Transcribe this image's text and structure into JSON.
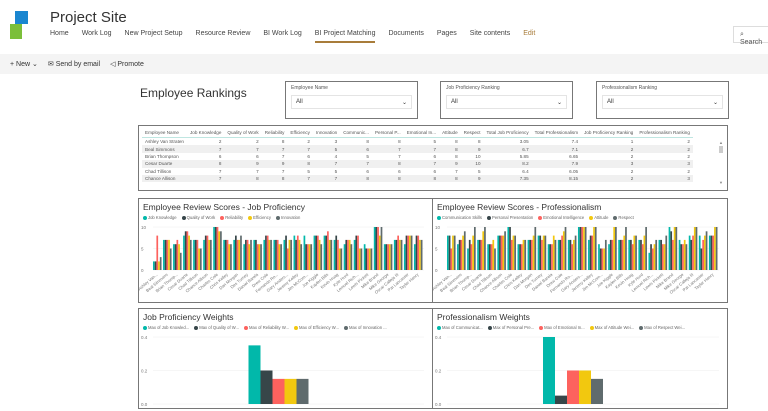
{
  "header": {
    "site_title": "Project Site",
    "nav": [
      "Home",
      "Work Log",
      "New Project Setup",
      "Resource Review",
      "BI Work Log",
      "BI Project Matching",
      "Documents",
      "Pages",
      "Site contents",
      "Edit"
    ],
    "active_nav": "BI Project Matching",
    "search_placeholder": "Search"
  },
  "commandbar": {
    "new": "New",
    "send": "Send by email",
    "promote": "Promote"
  },
  "page_title": "Employee Rankings",
  "slicers": [
    {
      "label": "Employee Name",
      "value": "All"
    },
    {
      "label": "Job Proficiency Ranking",
      "value": "All"
    },
    {
      "label": "Professionalism Ranking",
      "value": "All"
    }
  ],
  "table": {
    "columns": [
      "Employee Name",
      "Job Knowledge",
      "Quality of Work",
      "Reliability",
      "Efficiency",
      "Innovation",
      "Communic...",
      "Personal P...",
      "Emotional In...",
      "Attitude",
      "Respect",
      "Total Job Proficiency",
      "Total Professionalism",
      "Job Proficiency Ranking",
      "Professionalism Ranking"
    ],
    "rows": [
      [
        "Ashley Van Straten",
        "2",
        "2",
        "8",
        "2",
        "3",
        "8",
        "8",
        "5",
        "8",
        "8",
        "3.05",
        "7.4",
        "1",
        "2"
      ],
      [
        "Beal Simmons",
        "7",
        "7",
        "7",
        "7",
        "5",
        "6",
        "7",
        "7",
        "8",
        "9",
        "6.7",
        "7.1",
        "2",
        "2"
      ],
      [
        "Brian Thompson",
        "6",
        "6",
        "7",
        "6",
        "4",
        "5",
        "7",
        "6",
        "8",
        "10",
        "5.85",
        "6.65",
        "2",
        "2"
      ],
      [
        "Cesar Duarte",
        "8",
        "9",
        "9",
        "8",
        "7",
        "7",
        "8",
        "7",
        "9",
        "10",
        "8.2",
        "7.9",
        "3",
        "3"
      ],
      [
        "Chad Tillison",
        "7",
        "7",
        "7",
        "5",
        "5",
        "6",
        "6",
        "6",
        "7",
        "5",
        "6.4",
        "6.05",
        "2",
        "2"
      ],
      [
        "Chance Allison",
        "7",
        "8",
        "8",
        "7",
        "7",
        "8",
        "8",
        "8",
        "8",
        "9",
        "7.35",
        "8.15",
        "2",
        "3"
      ]
    ]
  },
  "colors": [
    "#01b8aa",
    "#374649",
    "#fd625e",
    "#f2c80f",
    "#5f6b6d"
  ],
  "chart_data": [
    {
      "type": "bar",
      "title": "Employee Review Scores - Job Proficiency",
      "ylim": [
        0,
        10
      ],
      "yticks": [
        "0",
        "5",
        "10"
      ],
      "categories": [
        "Ashley Van...",
        "Beal Simmons",
        "Brian Thomp...",
        "Cesar Duarte",
        "Chad Tillison",
        "Chance Allison",
        "Charles Cole",
        "Chris Kelley",
        "Dan Morgan",
        "Des Turney",
        "Daniel Barela",
        "Drew Cole",
        "Fernando Ro...",
        "Gary Anders...",
        "Jeremy Kelley",
        "Jim McCom...",
        "Joe Kiggle",
        "Kaylen Bills",
        "Kevin Hoag",
        "Kyle Hurd",
        "Lemuel Rich...",
        "Lewis Pickett",
        "Mike Brand",
        "Mike George",
        "Oscar Calleja III",
        "Pat Lancaster",
        "Tayler Henry"
      ],
      "series": [
        {
          "name": "Job Knowledge",
          "values": [
            2,
            7,
            6,
            8,
            7,
            7,
            10,
            7,
            7,
            6,
            7,
            7,
            7,
            7,
            8,
            8,
            8,
            8,
            7,
            6,
            7,
            6,
            10,
            6,
            7,
            6,
            6
          ]
        },
        {
          "name": "Quality of Work",
          "values": [
            2,
            7,
            6,
            9,
            7,
            8,
            10,
            7,
            8,
            7,
            7,
            8,
            7,
            8,
            7,
            6,
            8,
            8,
            8,
            7,
            8,
            5,
            10,
            6,
            7,
            8,
            8
          ]
        },
        {
          "name": "Reliability",
          "values": [
            8,
            7,
            7,
            9,
            7,
            8,
            10,
            7,
            7,
            7,
            6,
            8,
            7,
            5,
            8,
            6,
            8,
            9,
            7,
            7,
            8,
            5,
            10,
            6,
            8,
            8,
            8
          ]
        },
        {
          "name": "Efficiency",
          "values": [
            2,
            7,
            6,
            8,
            5,
            7,
            9,
            6,
            7,
            6,
            6,
            7,
            6,
            7,
            7,
            6,
            7,
            7,
            5,
            7,
            5,
            5,
            8,
            6,
            7,
            8,
            7
          ]
        },
        {
          "name": "Innovation",
          "values": [
            3,
            5,
            4,
            7,
            5,
            7,
            9,
            6,
            8,
            7,
            6,
            7,
            6,
            7,
            6,
            6,
            6,
            7,
            5,
            6,
            5,
            5,
            10,
            6,
            7,
            8,
            7
          ]
        }
      ]
    },
    {
      "type": "bar",
      "title": "Employee Review Scores - Professionalism",
      "ylim": [
        0,
        10
      ],
      "yticks": [
        "0",
        "5",
        "10"
      ],
      "categories": [
        "Ashley Van...",
        "Beal Simmons",
        "Brian Thomp...",
        "Cesar Duarte",
        "Chad Tillison",
        "Chance Allison",
        "Charles Cole",
        "Chris Kelley",
        "Dan Morgan",
        "Des Turney",
        "Daniel Barela",
        "Drew Cole",
        "Fernando Ro...",
        "Gary Anders...",
        "Jeremy Kelley",
        "Jim McCom...",
        "Joe Kiggle",
        "Kaylen Bills",
        "Kevin Hoag",
        "Kyle Hurd",
        "Lemuel Rich...",
        "Lewis Pickett",
        "Mike Brand",
        "Mike George",
        "Oscar Calleja III",
        "Pat Lancaster",
        "Tayler Henry"
      ],
      "series": [
        {
          "name": "Communication Skills",
          "values": [
            8,
            6,
            5,
            7,
            6,
            8,
            10,
            6,
            7,
            8,
            6,
            7,
            7,
            10,
            7,
            6,
            6,
            7,
            7,
            7,
            4,
            7,
            10,
            7,
            8,
            8,
            8
          ]
        },
        {
          "name": "Personal Presentation",
          "values": [
            8,
            7,
            7,
            7,
            6,
            8,
            10,
            6,
            7,
            8,
            6,
            7,
            7,
            10,
            8,
            5,
            7,
            7,
            7,
            7,
            6,
            7,
            9,
            6,
            7,
            5,
            8
          ]
        },
        {
          "name": "Emotional Intelligence",
          "values": [
            5,
            7,
            6,
            7,
            6,
            8,
            7,
            6,
            7,
            7,
            6,
            8,
            6,
            10,
            8,
            5,
            7,
            7,
            6,
            6,
            5,
            6,
            7,
            6,
            8,
            7,
            8
          ]
        },
        {
          "name": "Attitude",
          "values": [
            8,
            8,
            8,
            9,
            7,
            8,
            8,
            7,
            8,
            8,
            8,
            9,
            7,
            10,
            10,
            5,
            10,
            8,
            8,
            8,
            6,
            6,
            10,
            7,
            10,
            8,
            10
          ]
        },
        {
          "name": "Respect",
          "values": [
            8,
            9,
            10,
            10,
            5,
            9,
            8,
            7,
            10,
            8,
            7,
            10,
            8,
            10,
            10,
            7,
            10,
            10,
            8,
            10,
            7,
            8,
            10,
            6,
            10,
            9,
            10
          ]
        }
      ]
    },
    {
      "type": "bar",
      "title": "Job Proficiency Weights",
      "ylim": [
        0,
        0.4
      ],
      "yticks": [
        "0.0",
        "0.2",
        "0.4"
      ],
      "categories": [
        ""
      ],
      "series": [
        {
          "name": "Max of Job Knowled...",
          "values": [
            0.35
          ]
        },
        {
          "name": "Max of Quality of W...",
          "values": [
            0.2
          ]
        },
        {
          "name": "Max of Reliability W...",
          "values": [
            0.15
          ]
        },
        {
          "name": "Max of Efficiency W...",
          "values": [
            0.15
          ]
        },
        {
          "name": "Max of Innovation ...",
          "values": [
            0.15
          ]
        }
      ]
    },
    {
      "type": "bar",
      "title": "Professionalism Weights",
      "ylim": [
        0,
        0.4
      ],
      "yticks": [
        "0.0",
        "0.2",
        "0.4"
      ],
      "categories": [
        ""
      ],
      "series": [
        {
          "name": "Max of Communicat...",
          "values": [
            0.4
          ]
        },
        {
          "name": "Max of Personal Pre...",
          "values": [
            0.05
          ]
        },
        {
          "name": "Max of Emotional In...",
          "values": [
            0.2
          ]
        },
        {
          "name": "Max of Attitude Wei...",
          "values": [
            0.2
          ]
        },
        {
          "name": "Max of Respect Wei...",
          "values": [
            0.15
          ]
        }
      ]
    }
  ]
}
